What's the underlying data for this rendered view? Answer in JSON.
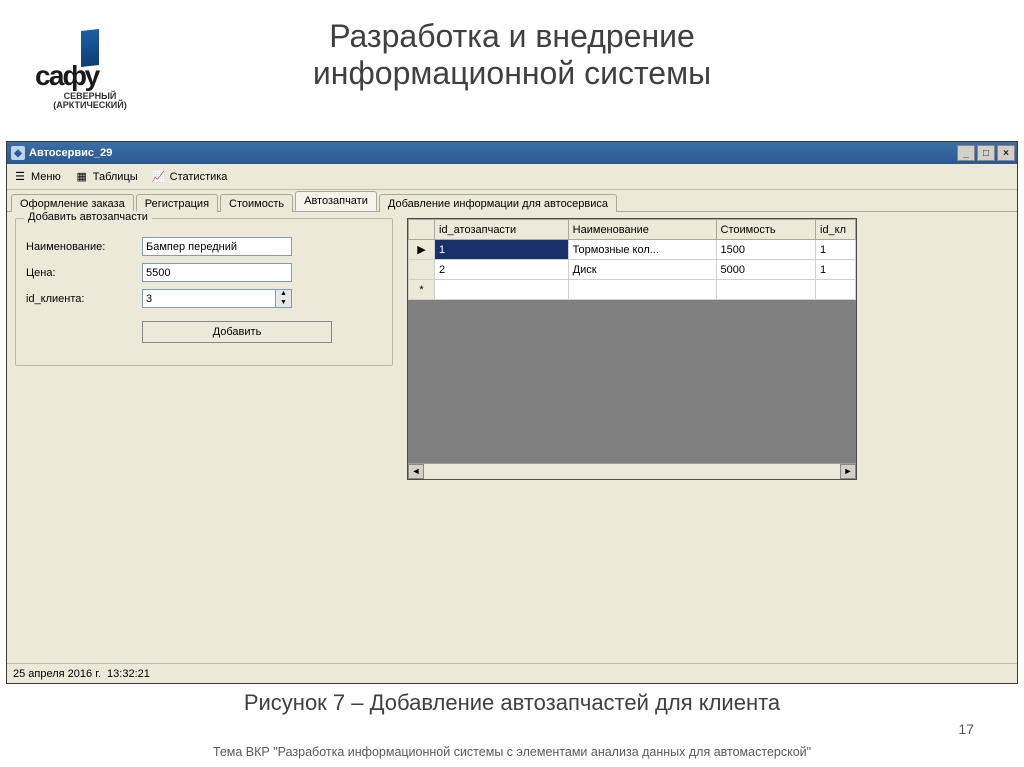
{
  "slide": {
    "title_line1": "Разработка и внедрение",
    "title_line2": "информационной системы",
    "caption": "Рисунок 7 – Добавление автозапчастей для клиента",
    "footer": "Тема ВКР \"Разработка информационной системы с элементами анализа данных для автомастерской\"",
    "pagenum": "17"
  },
  "logo": {
    "text": "сафу",
    "sub1": "СЕВЕРНЫЙ",
    "sub2": "(АРКТИЧЕСКИЙ)"
  },
  "window": {
    "title": "Автосервис_29"
  },
  "toolbar": {
    "menu": "Меню",
    "tables": "Таблицы",
    "stats": "Статистика"
  },
  "tabs": {
    "items": [
      {
        "label": "Оформление заказа"
      },
      {
        "label": "Регистрация"
      },
      {
        "label": "Стоимость"
      },
      {
        "label": "Автозапчати"
      },
      {
        "label": "Добавление информации для автосервиса"
      }
    ]
  },
  "form": {
    "legend": "Добавить автозапчасти",
    "name_label": "Наименование:",
    "name_value": "Бампер передний",
    "price_label": "Цена:",
    "price_value": "5500",
    "client_label": "id_клиента:",
    "client_value": "3",
    "add_button": "Добавить"
  },
  "grid": {
    "cols": [
      "id_атозапчасти",
      "Наименование",
      "Стоимость",
      "id_кл"
    ],
    "rows": [
      {
        "id": "1",
        "name": "Тормозные кол...",
        "cost": "1500",
        "client": "1"
      },
      {
        "id": "2",
        "name": "Диск",
        "cost": "5000",
        "client": "1"
      }
    ]
  },
  "status": {
    "date": "25 апреля 2016 г.",
    "time": "13:32:21"
  }
}
